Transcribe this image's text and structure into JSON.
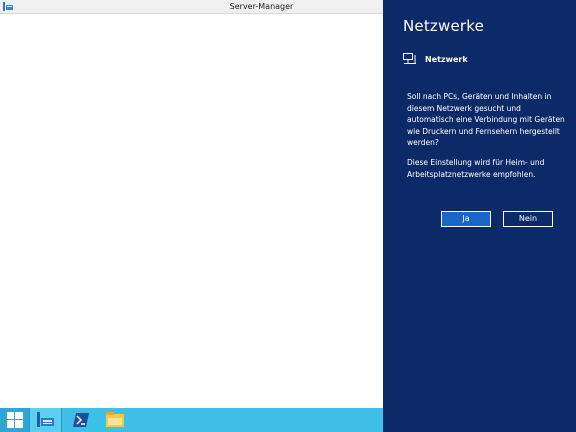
{
  "window": {
    "title": "Server-Manager",
    "icon": "server-manager-icon"
  },
  "panel": {
    "title": "Netzwerke",
    "network_name": "Netzwerk",
    "network_icon": "network-icon",
    "question": "Soll nach PCs, Geräten und Inhalten in diesem Netzwerk gesucht und automatisch eine Verbindung mit Geräten wie Druckern und Fernsehern hergestellt werden?",
    "recommendation": "Diese Einstellung wird für Heim- und Arbeitsplatznetzwerke empfohlen.",
    "yes_label": "Ja",
    "no_label": "Nein",
    "background_color": "#0d2a68",
    "accent_color": "#1a66c7"
  },
  "taskbar": {
    "color": "#3ebfe8",
    "items": [
      {
        "icon": "windows-start-icon"
      },
      {
        "icon": "server-manager-icon"
      },
      {
        "icon": "powershell-icon"
      },
      {
        "icon": "file-explorer-icon"
      }
    ]
  }
}
